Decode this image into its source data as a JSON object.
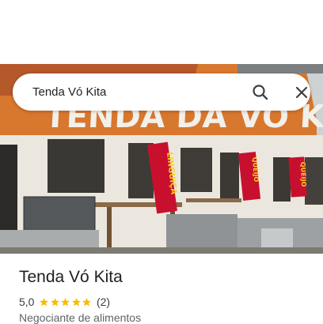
{
  "search": {
    "query": "Tenda Vó Kita",
    "search_icon": "search-icon",
    "close_icon": "close-icon"
  },
  "photo": {
    "sign_text": "TENDA DA VÓ KITA",
    "banners": [
      "LINGUIÇA",
      "QUEIJO",
      "QUEIJO"
    ]
  },
  "place": {
    "name": "Tenda Vó Kita",
    "rating": "5,0",
    "stars": 5,
    "review_count": "(2)",
    "category": "Negociante de alimentos"
  },
  "colors": {
    "star": "#fbbc04",
    "banner_red": "#c8102e",
    "text_primary": "#202124"
  }
}
